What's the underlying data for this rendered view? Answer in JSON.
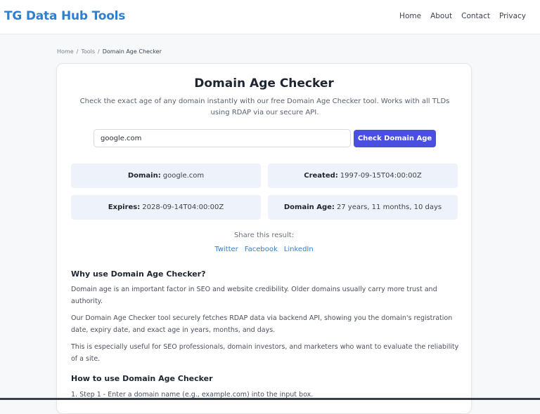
{
  "header": {
    "brand": "TG Data Hub Tools",
    "nav": [
      "Home",
      "About",
      "Contact",
      "Privacy"
    ]
  },
  "breadcrumb": {
    "home": "Home",
    "sep1": "/",
    "tools": "Tools",
    "sep2": "/",
    "current": "Domain Age Checker"
  },
  "tool": {
    "title": "Domain Age Checker",
    "intro": "Check the exact age of any domain instantly with our free Domain Age Checker tool. Works with all TLDs using RDAP via our secure API.",
    "input_value": "google.com",
    "button_label": "Check Domain Age"
  },
  "results": {
    "domain_label": "Domain:",
    "domain_value": "google.com",
    "created_label": "Created:",
    "created_value": "1997-09-15T04:00:00Z",
    "expires_label": "Expires:",
    "expires_value": "2028-09-14T04:00:00Z",
    "age_label": "Domain Age:",
    "age_value": "27 years, 11 months, 10 days"
  },
  "share": {
    "label": "Share this result:",
    "twitter": "Twitter",
    "facebook": "Facebook",
    "linkedin": "LinkedIn"
  },
  "content": {
    "why_heading": "Why use Domain Age Checker?",
    "p1": "Domain age is an important factor in SEO and website credibility. Older domains usually carry more trust and authority.",
    "p2": "Our Domain Age Checker tool securely fetches RDAP data via backend API, showing you the domain's registration date, expiry date, and exact age in years, months, and days.",
    "p3": "This is especially useful for SEO professionals, domain investors, and marketers who want to evaluate the reliability of a site.",
    "how_heading": "How to use Domain Age Checker",
    "step1": "1. Step 1 - Enter a domain name (e.g., example.com) into the input box."
  },
  "colors": {
    "brand": "#2f7fd1",
    "button": "#4b4fe0",
    "result_bg": "#eef2fa"
  }
}
